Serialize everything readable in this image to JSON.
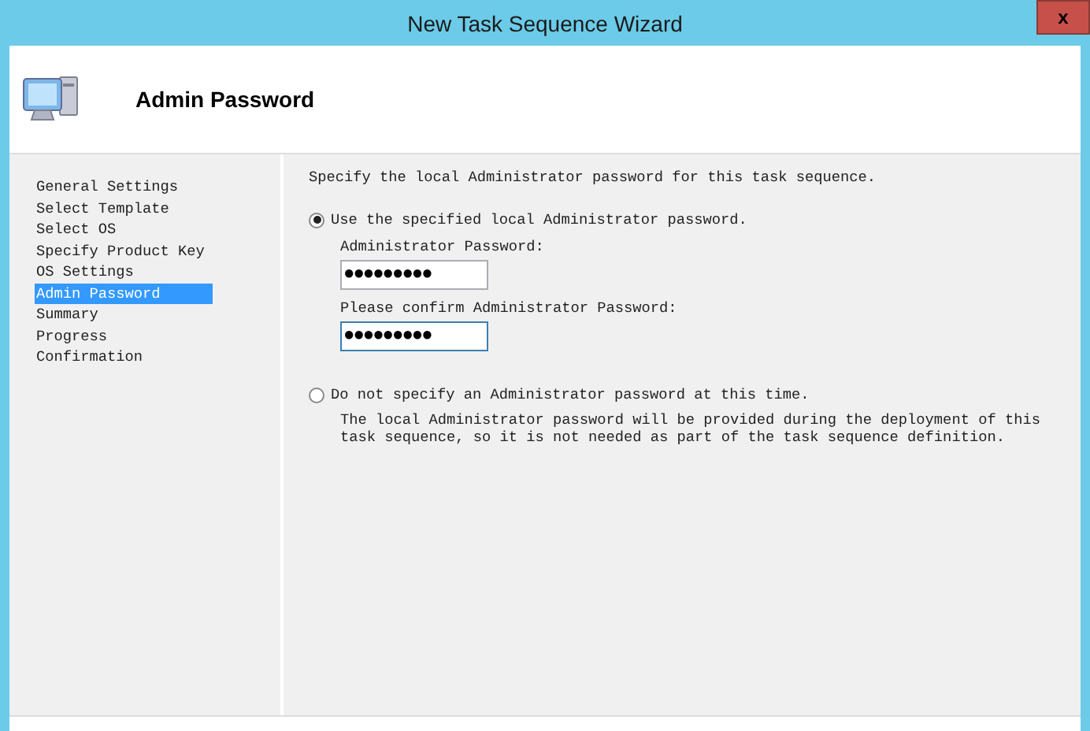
{
  "window": {
    "title": "New Task Sequence Wizard",
    "close": "x"
  },
  "header": {
    "title": "Admin Password"
  },
  "steps": [
    {
      "label": "General Settings",
      "selected": false
    },
    {
      "label": "Select Template",
      "selected": false
    },
    {
      "label": "Select OS",
      "selected": false
    },
    {
      "label": "Specify Product Key",
      "selected": false
    },
    {
      "label": "OS Settings",
      "selected": false
    },
    {
      "label": "Admin Password",
      "selected": true
    },
    {
      "label": "Summary",
      "selected": false
    },
    {
      "label": "Progress",
      "selected": false
    },
    {
      "label": "Confirmation",
      "selected": false
    }
  ],
  "intro": "Specify the local Administrator password for this task sequence.",
  "options": [
    {
      "label": "Use the specified local Administrator password.",
      "selected": true,
      "fields": [
        {
          "label": "Administrator Password:",
          "value": "●●●●●●●●●",
          "focused": false
        },
        {
          "label": "Please confirm Administrator Password:",
          "value": "●●●●●●●●●",
          "focused": true
        }
      ]
    },
    {
      "label": "Do not specify an Administrator password at this time.",
      "selected": false,
      "note": "The local Administrator password will be provided during the deployment of this task sequence, so it is not needed as part of the task sequence definition."
    }
  ]
}
